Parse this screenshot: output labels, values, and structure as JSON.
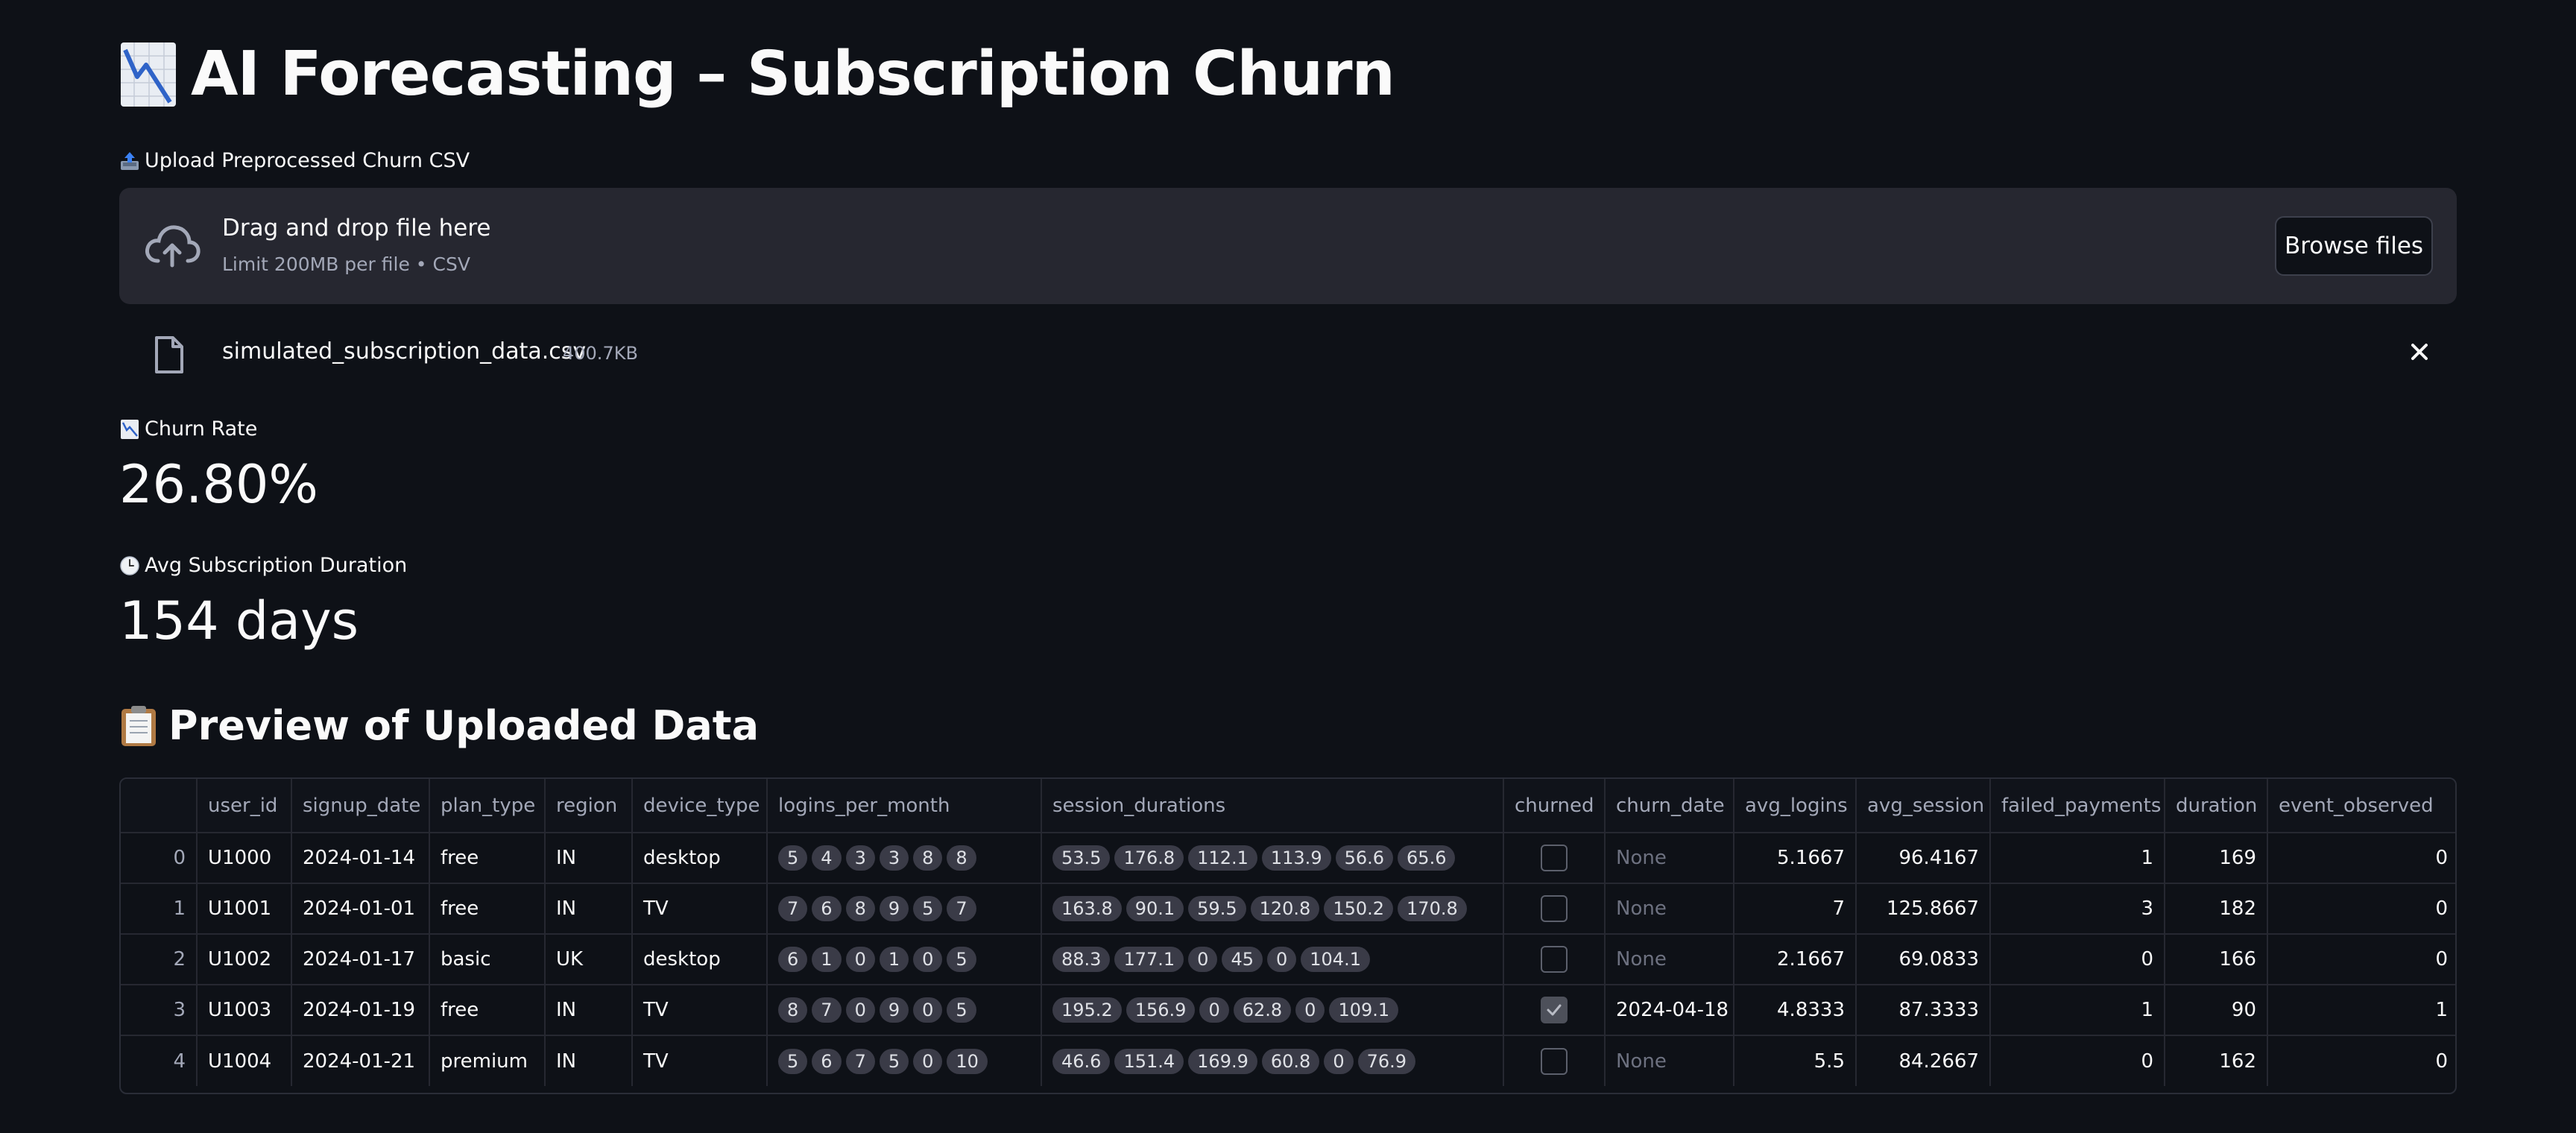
{
  "header": {
    "title": "AI Forecasting – Subscription Churn",
    "icon": "chart-decreasing-icon"
  },
  "uploader": {
    "label": "Upload Preprocessed Churn CSV",
    "label_icon": "outbox-tray-icon",
    "drop_title": "Drag and drop file here",
    "drop_subtitle": "Limit 200MB per file • CSV",
    "browse_label": "Browse files",
    "file": {
      "name": "simulated_subscription_data.csv",
      "size": "400.7KB"
    }
  },
  "metrics": [
    {
      "label": "Churn Rate",
      "icon": "chart-decreasing-icon",
      "value": "26.80%"
    },
    {
      "label": "Avg Subscription Duration",
      "icon": "clock-icon",
      "value": "154 days"
    }
  ],
  "preview": {
    "title": "Preview of Uploaded Data",
    "icon": "clipboard-icon",
    "columns": [
      "",
      "user_id",
      "signup_date",
      "plan_type",
      "region",
      "device_type",
      "logins_per_month",
      "session_durations",
      "churned",
      "churn_date",
      "avg_logins",
      "avg_session",
      "failed_payments",
      "duration",
      "event_observed"
    ],
    "rows": [
      {
        "index": "0",
        "user_id": "U1000",
        "signup_date": "2024-01-14",
        "plan_type": "free",
        "region": "IN",
        "device_type": "desktop",
        "logins": [
          "5",
          "4",
          "3",
          "3",
          "8",
          "8"
        ],
        "sessions": [
          "53.5",
          "176.8",
          "112.1",
          "113.9",
          "56.6",
          "65.6"
        ],
        "churned": false,
        "churn_date": "None",
        "avg_logins": "5.1667",
        "avg_session": "96.4167",
        "failed_payments": "1",
        "duration": "169",
        "event_observed": "0"
      },
      {
        "index": "1",
        "user_id": "U1001",
        "signup_date": "2024-01-01",
        "plan_type": "free",
        "region": "IN",
        "device_type": "TV",
        "logins": [
          "7",
          "6",
          "8",
          "9",
          "5",
          "7"
        ],
        "sessions": [
          "163.8",
          "90.1",
          "59.5",
          "120.8",
          "150.2",
          "170.8"
        ],
        "churned": false,
        "churn_date": "None",
        "avg_logins": "7",
        "avg_session": "125.8667",
        "failed_payments": "3",
        "duration": "182",
        "event_observed": "0"
      },
      {
        "index": "2",
        "user_id": "U1002",
        "signup_date": "2024-01-17",
        "plan_type": "basic",
        "region": "UK",
        "device_type": "desktop",
        "logins": [
          "6",
          "1",
          "0",
          "1",
          "0",
          "5"
        ],
        "sessions": [
          "88.3",
          "177.1",
          "0",
          "45",
          "0",
          "104.1"
        ],
        "churned": false,
        "churn_date": "None",
        "avg_logins": "2.1667",
        "avg_session": "69.0833",
        "failed_payments": "0",
        "duration": "166",
        "event_observed": "0"
      },
      {
        "index": "3",
        "user_id": "U1003",
        "signup_date": "2024-01-19",
        "plan_type": "free",
        "region": "IN",
        "device_type": "TV",
        "logins": [
          "8",
          "7",
          "0",
          "9",
          "0",
          "5"
        ],
        "sessions": [
          "195.2",
          "156.9",
          "0",
          "62.8",
          "0",
          "109.1"
        ],
        "churned": true,
        "churn_date": "2024-04-18",
        "avg_logins": "4.8333",
        "avg_session": "87.3333",
        "failed_payments": "1",
        "duration": "90",
        "event_observed": "1"
      },
      {
        "index": "4",
        "user_id": "U1004",
        "signup_date": "2024-01-21",
        "plan_type": "premium",
        "region": "IN",
        "device_type": "TV",
        "logins": [
          "5",
          "6",
          "7",
          "5",
          "0",
          "10"
        ],
        "sessions": [
          "46.6",
          "151.4",
          "169.9",
          "60.8",
          "0",
          "76.9"
        ],
        "churned": false,
        "churn_date": "None",
        "avg_logins": "5.5",
        "avg_session": "84.2667",
        "failed_payments": "0",
        "duration": "162",
        "event_observed": "0"
      }
    ]
  }
}
